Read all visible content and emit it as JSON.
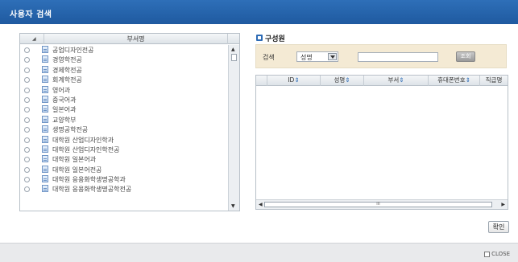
{
  "window": {
    "title": "사용자 검색",
    "close_label": "CLOSE"
  },
  "department_panel": {
    "header_label": "부서명",
    "items": [
      "공업디자인전공",
      "경영학전공",
      "경제학전공",
      "회계학전공",
      "영어과",
      "중국어과",
      "일본어과",
      "교양학부",
      "생명공학전공",
      "대학원 산업디자인학과",
      "대학원 산업디자인학전공",
      "대학원 일본어과",
      "대학원 일본어전공",
      "대학원 응용화학생명공학과",
      "대학원 응용화학생명공학전공"
    ]
  },
  "member_panel": {
    "title": "구성원",
    "search_label": "검색",
    "search_field_selected": "성명",
    "search_input_value": "",
    "search_button_label": "조회",
    "columns": [
      "ID",
      "성명",
      "부서",
      "휴대폰번호",
      "직급명"
    ],
    "hscroll_label": "III"
  },
  "footer": {
    "confirm_label": "확인"
  },
  "colors": {
    "titlebar": "#2567b0",
    "search_bg": "#f4ead4"
  }
}
